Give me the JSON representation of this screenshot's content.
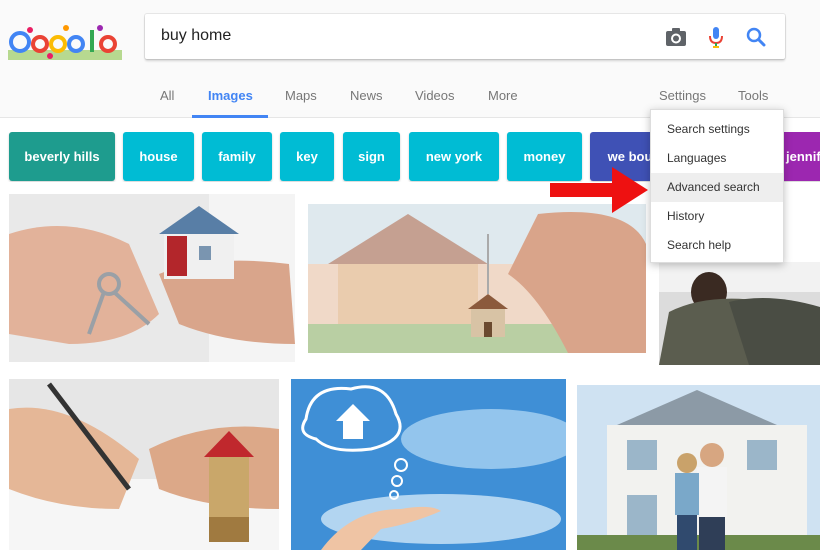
{
  "logo": {
    "label": "Google"
  },
  "search": {
    "query": "buy home"
  },
  "tabs": {
    "all": "All",
    "images": "Images",
    "maps": "Maps",
    "news": "News",
    "videos": "Videos",
    "more": "More",
    "settings": "Settings",
    "tools": "Tools",
    "active": "Images"
  },
  "chips": [
    {
      "label": "beverly hills",
      "color": "#1e9c8e"
    },
    {
      "label": "house",
      "color": "#00bcd4"
    },
    {
      "label": "family",
      "color": "#00bcd4"
    },
    {
      "label": "key",
      "color": "#00bcd4"
    },
    {
      "label": "sign",
      "color": "#00bcd4"
    },
    {
      "label": "new york",
      "color": "#00bcd4"
    },
    {
      "label": "money",
      "color": "#00bcd4"
    },
    {
      "label": "we bou",
      "color": "#3f51b5"
    },
    {
      "label": "jennif",
      "color": "#9c27b0"
    }
  ],
  "settings_menu": {
    "items": [
      "Search settings",
      "Languages",
      "Advanced search",
      "History",
      "Search help"
    ],
    "highlighted": "Advanced search"
  },
  "colors": {
    "accent": "#4285f4",
    "arrow": "#ee1111"
  },
  "icons": [
    "camera-icon",
    "microphone-icon",
    "search-icon",
    "red-arrow-icon"
  ]
}
